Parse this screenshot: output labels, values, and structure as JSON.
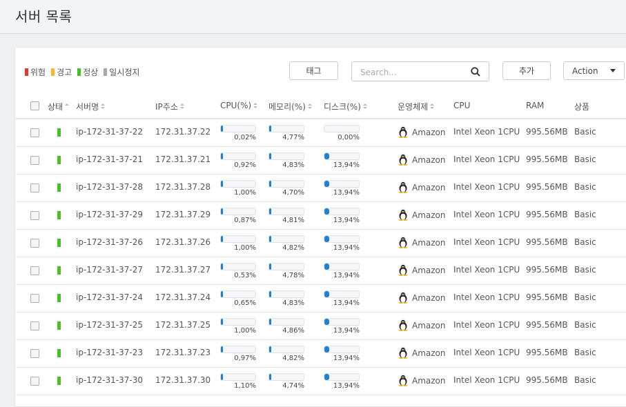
{
  "page_title": "서버 목록",
  "legend": [
    {
      "label": "위험",
      "color": "#e53935"
    },
    {
      "label": "경고",
      "color": "#f5b631"
    },
    {
      "label": "정상",
      "color": "#44c124"
    },
    {
      "label": "일시정지",
      "color": "#a8a8a8"
    }
  ],
  "toolbar": {
    "tag_label": "태그",
    "search_placeholder": "Search...",
    "add_label": "추가",
    "action_label": "Action"
  },
  "columns": {
    "status": "상태",
    "name": "서버명",
    "ip": "IP주소",
    "cpu_pct": "CPU(%)",
    "mem_pct": "메모리(%)",
    "disk_pct": "디스크(%)",
    "os": "운영체제",
    "cpu": "CPU",
    "ram": "RAM",
    "product": "상품"
  },
  "rows": [
    {
      "name": "ip-172-31-37-22",
      "ip": "172.31.37.22",
      "cpu": "0,02%",
      "cpu_v": 0.02,
      "mem": "4,77%",
      "mem_v": 4.77,
      "disk": "0,00%",
      "disk_v": 0.0,
      "os": "Amazon",
      "cpu_model": "Intel Xeon 1CPU",
      "ram": "995.56MB",
      "product": "Basic"
    },
    {
      "name": "ip-172-31-37-21",
      "ip": "172.31.37.21",
      "cpu": "0,92%",
      "cpu_v": 0.92,
      "mem": "4,83%",
      "mem_v": 4.83,
      "disk": "13,94%",
      "disk_v": 13.94,
      "os": "Amazon",
      "cpu_model": "Intel Xeon 1CPU",
      "ram": "995.56MB",
      "product": "Basic"
    },
    {
      "name": "ip-172-31-37-28",
      "ip": "172.31.37.28",
      "cpu": "1,00%",
      "cpu_v": 1.0,
      "mem": "4,70%",
      "mem_v": 4.7,
      "disk": "13,94%",
      "disk_v": 13.94,
      "os": "Amazon",
      "cpu_model": "Intel Xeon 1CPU",
      "ram": "995.56MB",
      "product": "Basic"
    },
    {
      "name": "ip-172-31-37-29",
      "ip": "172.31.37.29",
      "cpu": "0,87%",
      "cpu_v": 0.87,
      "mem": "4,81%",
      "mem_v": 4.81,
      "disk": "13,94%",
      "disk_v": 13.94,
      "os": "Amazon",
      "cpu_model": "Intel Xeon 1CPU",
      "ram": "995.56MB",
      "product": "Basic"
    },
    {
      "name": "ip-172-31-37-26",
      "ip": "172.31.37.26",
      "cpu": "1,00%",
      "cpu_v": 1.0,
      "mem": "4,82%",
      "mem_v": 4.82,
      "disk": "13,94%",
      "disk_v": 13.94,
      "os": "Amazon",
      "cpu_model": "Intel Xeon 1CPU",
      "ram": "995.56MB",
      "product": "Basic"
    },
    {
      "name": "ip-172-31-37-27",
      "ip": "172.31.37.27",
      "cpu": "0,53%",
      "cpu_v": 0.53,
      "mem": "4,78%",
      "mem_v": 4.78,
      "disk": "13,94%",
      "disk_v": 13.94,
      "os": "Amazon",
      "cpu_model": "Intel Xeon 1CPU",
      "ram": "995.56MB",
      "product": "Basic"
    },
    {
      "name": "ip-172-31-37-24",
      "ip": "172.31.37.24",
      "cpu": "0,65%",
      "cpu_v": 0.65,
      "mem": "4,83%",
      "mem_v": 4.83,
      "disk": "13,94%",
      "disk_v": 13.94,
      "os": "Amazon",
      "cpu_model": "Intel Xeon 1CPU",
      "ram": "995.56MB",
      "product": "Basic"
    },
    {
      "name": "ip-172-31-37-25",
      "ip": "172.31.37.25",
      "cpu": "1,00%",
      "cpu_v": 1.0,
      "mem": "4,86%",
      "mem_v": 4.86,
      "disk": "13,94%",
      "disk_v": 13.94,
      "os": "Amazon",
      "cpu_model": "Intel Xeon 1CPU",
      "ram": "995.56MB",
      "product": "Basic"
    },
    {
      "name": "ip-172-31-37-23",
      "ip": "172.31.37.23",
      "cpu": "0,97%",
      "cpu_v": 0.97,
      "mem": "4,82%",
      "mem_v": 4.82,
      "disk": "13,94%",
      "disk_v": 13.94,
      "os": "Amazon",
      "cpu_model": "Intel Xeon 1CPU",
      "ram": "995.56MB",
      "product": "Basic"
    },
    {
      "name": "ip-172-31-37-30",
      "ip": "172.31.37.30",
      "cpu": "1,10%",
      "cpu_v": 1.1,
      "mem": "4,74%",
      "mem_v": 4.74,
      "disk": "13,94%",
      "disk_v": 13.94,
      "os": "Amazon",
      "cpu_model": "Intel Xeon 1CPU",
      "ram": "995.56MB",
      "product": "Basic"
    }
  ],
  "row_status_color": "#44c124",
  "meter_color": "#1f7fd1",
  "os_icon": "linux-tux-icon"
}
